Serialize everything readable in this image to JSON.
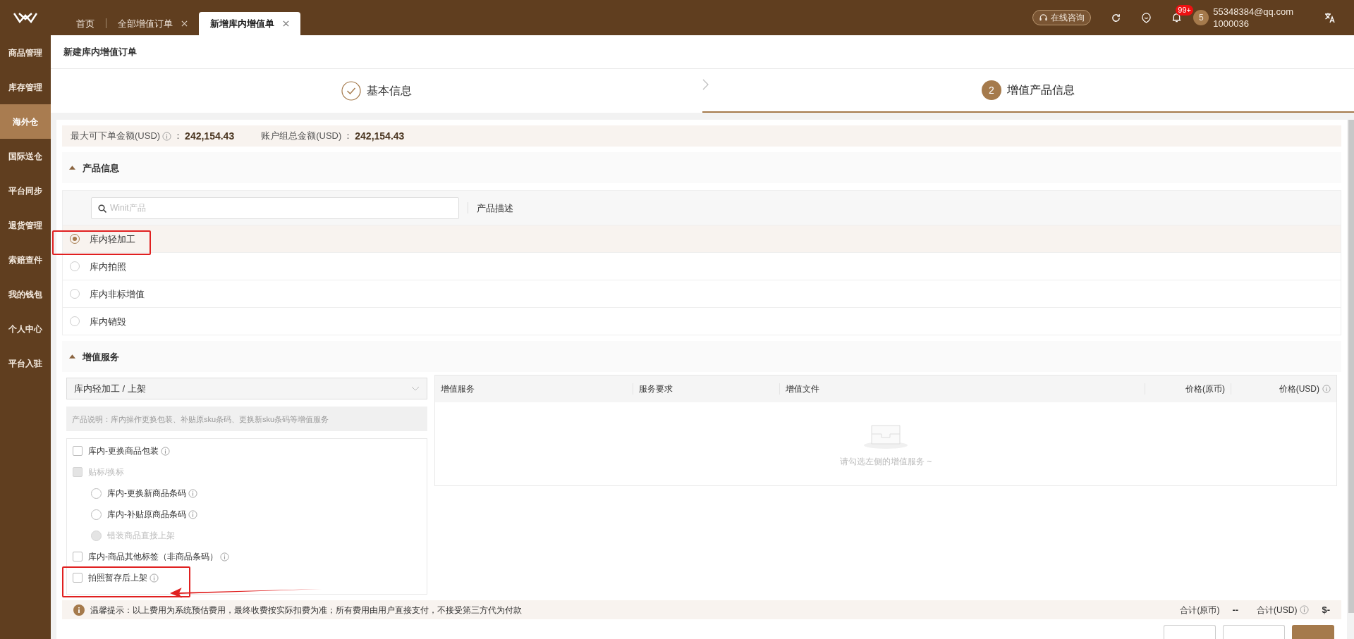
{
  "tabs": [
    {
      "label": "首页",
      "selected": false,
      "closable": false
    },
    {
      "label": "全部增值订单",
      "selected": false,
      "closable": true
    },
    {
      "label": "新增库内增值单",
      "selected": true,
      "closable": true
    }
  ],
  "header": {
    "consult_button": "在线咨询",
    "notification_badge": "99+",
    "avatar": "5",
    "email": "55348384@qq.com",
    "account_id": "1000036"
  },
  "sidebar": {
    "items": [
      {
        "label": "商品管理",
        "selected": false
      },
      {
        "label": "库存管理",
        "selected": false
      },
      {
        "label": "海外仓",
        "selected": true
      },
      {
        "label": "国际送仓",
        "selected": false
      },
      {
        "label": "平台同步",
        "selected": false
      },
      {
        "label": "退货管理",
        "selected": false
      },
      {
        "label": "索赔查件",
        "selected": false
      },
      {
        "label": "我的钱包",
        "selected": false
      },
      {
        "label": "个人中心",
        "selected": false
      },
      {
        "label": "平台入驻",
        "selected": false
      }
    ]
  },
  "page_title": "新建库内增值订单",
  "steps": [
    {
      "label": "基本信息",
      "selected": false
    },
    {
      "number": "2",
      "label": "增值产品信息",
      "selected": true
    }
  ],
  "summary": [
    {
      "label": "最大可下单金额(USD)",
      "info": true,
      "separator": "：",
      "value": "242,154.43"
    },
    {
      "label": "账户组总金额(USD)",
      "info": false,
      "separator": "：",
      "value": "242,154.43"
    }
  ],
  "product_section": {
    "title": "产品信息",
    "expanded": true,
    "search": {
      "placeholder": "Winit产品"
    },
    "column_label": "产品描述",
    "products": [
      {
        "label": "库内轻加工",
        "selected": true
      },
      {
        "label": "库内拍照",
        "selected": false
      },
      {
        "label": "库内非标增值",
        "selected": false
      },
      {
        "label": "库内销毁",
        "selected": false
      }
    ]
  },
  "service_section": {
    "title": "增值服务",
    "expanded": true,
    "select": {
      "value": "库内轻加工 / 上架"
    },
    "description": "产品说明：库内操作更换包装、补贴原sku条码、更换新sku条码等增值服务",
    "options": [
      {
        "kind": "checkbox",
        "label": "库内-更换商品包装",
        "checked": false,
        "disabled": false,
        "info": true
      },
      {
        "kind": "checkbox",
        "label": "贴标/换标",
        "checked": false,
        "disabled": true,
        "info": false,
        "children": [
          {
            "kind": "radio",
            "label": "库内-更换新商品条码",
            "selected": false,
            "disabled": false,
            "info": true
          },
          {
            "kind": "radio",
            "label": "库内-补贴原商品条码",
            "selected": false,
            "disabled": false,
            "info": true
          },
          {
            "kind": "radio",
            "label": "错装商品直接上架",
            "selected": false,
            "disabled": true,
            "info": false
          }
        ]
      },
      {
        "kind": "checkbox",
        "label": "库内-商品其他标签（非商品条码）",
        "checked": false,
        "disabled": false,
        "info": true
      },
      {
        "kind": "checkbox",
        "label": "拍照暂存后上架",
        "checked": false,
        "disabled": false,
        "info": true
      }
    ],
    "table": {
      "columns": [
        {
          "label": "增值服务",
          "info": false
        },
        {
          "label": "服务要求",
          "info": false
        },
        {
          "label": "增值文件",
          "info": false
        },
        {
          "label": "价格(原币)",
          "info": false
        },
        {
          "label": "价格(USD)",
          "info": true
        }
      ],
      "empty_text": "请勾选左侧的增值服务 ~"
    }
  },
  "tip": "温馨提示：以上费用为系统预估费用，最终收费按实际扣费为准；所有费用由用户直接支付，不接受第三方代为付款",
  "totals": [
    {
      "label": "合计(原币)",
      "info": false,
      "value": "--"
    },
    {
      "label": "合计(USD)",
      "info": true,
      "value": "$-"
    }
  ]
}
